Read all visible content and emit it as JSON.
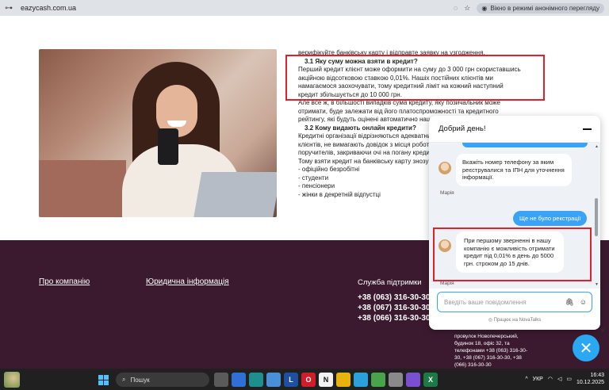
{
  "browser": {
    "url": "eazycash.com.ua",
    "incognito_label": "Вікно в режимі анонімного перегляду"
  },
  "article": {
    "lines": [
      {
        "text": "верифікуйте банківську карту і відправте заявку на узгодження.",
        "bold": false
      },
      {
        "text": "3.1 Яку суму можна взяти в кредит?",
        "bold": true
      },
      {
        "text": "Перший кредит клієнт може оформити на суму до 3 000 грн скориставшись",
        "bold": false
      },
      {
        "text": "акційною відсотковою ставкою 0,01%. Нашіх постійних клієнтів ми",
        "bold": false
      },
      {
        "text": "намагаємося заохочувати, тому кредитний ліміт на кожний наступний",
        "bold": false
      },
      {
        "text": "кредит збільшується до 10 000 грн.",
        "bold": false
      },
      {
        "text": "Але все ж, в більшості випадків сума кредиту, яку позичальник може",
        "bold": false
      },
      {
        "text": "отримати, буде залежати від його платоспроможності та кредитного",
        "bold": false
      },
      {
        "text": "рейтингу, які будуть оцінені автоматично наш",
        "bold": false
      },
      {
        "text": "3.2 Кому видають онлайн кредити?",
        "bold": true
      },
      {
        "text": "Кредитні організації відрізняються адекватни",
        "bold": false
      },
      {
        "text": "клієнтів, не вимагають довідок з місця роботи",
        "bold": false
      },
      {
        "text": "поручителів, закриваючи очі на погану кредит",
        "bold": false
      },
      {
        "text": "Тому взяти кредит на банківську карту знозу",
        "bold": false
      },
      {
        "text": "- офіційно безробітні",
        "bold": false
      },
      {
        "text": "- студенти",
        "bold": false
      },
      {
        "text": "- пенсіонери",
        "bold": false
      },
      {
        "text": "- жінки в декретній відпустці",
        "bold": false
      }
    ]
  },
  "footer": {
    "about_link": "Про компанію",
    "legal_link": "Юридична інформація",
    "support_title": "Служба підтримки",
    "phones": [
      "+38 (063) 316-30-30",
      "+38 (067) 316-30-30",
      "+38 (066) 316-30-30"
    ],
    "address_lines": [
      "провулок Новопечерський,",
      "будинок 18, офіс 32, та",
      "телефонами +38 (063) 316-30-",
      "30, +38 (067) 316-30-30, +38",
      "(066) 316-30-30"
    ]
  },
  "chat": {
    "title": "Добрий день!",
    "messages": [
      {
        "type": "in",
        "text": "Вкажіть номер телефону за яким реєструвалися та ІПН для уточнення інформації.",
        "sender": "Марія"
      },
      {
        "type": "out",
        "text": "Ще не було рекстрації"
      },
      {
        "type": "in",
        "text": "При першому зверненні в нашу компанію є можливість отримати кредит під 0,01% в день до 5000 грн. строком до 15 днів.",
        "sender": "Марія"
      }
    ],
    "input_placeholder": "Введіть ваше повідомлення",
    "powered_by": "Працює на NovaTalks"
  },
  "taskbar": {
    "search_label": "Пошук",
    "lang": "УКР",
    "time": "16:43",
    "date": "10.12.2025",
    "apps": [
      {
        "icon": "file-explorer-icon",
        "label": "",
        "color": "#5a5a5a"
      },
      {
        "icon": "store-icon",
        "label": "",
        "color": "#2f6fd6"
      },
      {
        "icon": "edge-icon",
        "label": "",
        "color": "#1f8e8e"
      },
      {
        "icon": "files-icon",
        "label": "",
        "color": "#4a90d9"
      },
      {
        "icon": "l-app-icon",
        "label": "L",
        "color": "#1e4fa1"
      },
      {
        "icon": "opera-icon",
        "label": "O",
        "color": "#d01d2a"
      },
      {
        "icon": "notion-icon",
        "label": "N",
        "color": "#f2f2f2"
      },
      {
        "icon": "chrome-icon",
        "label": "",
        "color": "#e8b30f"
      },
      {
        "icon": "telegram-icon",
        "label": "",
        "color": "#2aa1da"
      },
      {
        "icon": "app-green-icon",
        "label": "",
        "color": "#48a34a"
      },
      {
        "icon": "app-gray-icon",
        "label": "",
        "color": "#8a8a8a"
      },
      {
        "icon": "viber-icon",
        "label": "",
        "color": "#7b4fd1"
      },
      {
        "icon": "excel-icon",
        "label": "X",
        "color": "#1d7a44"
      }
    ]
  }
}
